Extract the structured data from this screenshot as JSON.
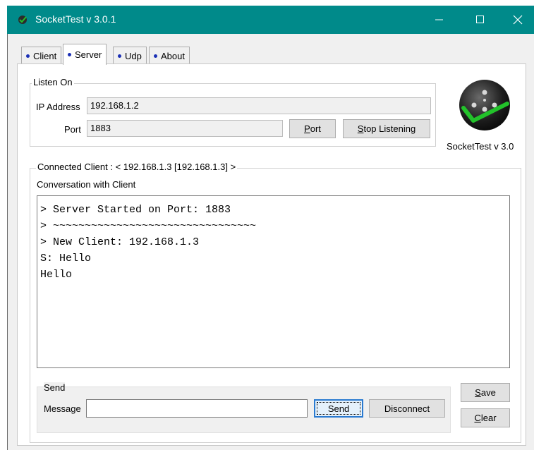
{
  "window": {
    "title": "SocketTest v 3.0.1",
    "controls": {
      "minimize": "—",
      "maximize": "☐",
      "close": "✕"
    }
  },
  "tabs": [
    {
      "label": "Client",
      "active": false
    },
    {
      "label": "Server",
      "active": true
    },
    {
      "label": "Udp",
      "active": false
    },
    {
      "label": "About",
      "active": false
    }
  ],
  "listen": {
    "legend": "Listen On",
    "ip_label": "IP Address",
    "ip_value": "192.168.1.2",
    "port_label": "Port",
    "port_value": "1883",
    "port_button_first": "P",
    "port_button_rest": "ort",
    "stop_button_first": "S",
    "stop_button_rest": "top Listening"
  },
  "logo": {
    "caption": "SocketTest v 3.0",
    "icon": "socket-logo-icon"
  },
  "connected": {
    "legend": "Connected Client : <  192.168.1.3 [192.168.1.3]  >",
    "conversation_label": "Conversation with Client",
    "lines": [
      "> Server Started on Port: 1883",
      "> ~~~~~~~~~~~~~~~~~~~~~~~~~~~~~~~~",
      "> New Client: 192.168.1.3",
      "S: Hello",
      "Hello"
    ]
  },
  "send": {
    "legend": "Send",
    "message_label": "Message",
    "message_value": "",
    "send_button": "Send",
    "disconnect_button": "Disconnect"
  },
  "side_buttons": {
    "save_first": "S",
    "save_rest": "ave",
    "clear_first": "C",
    "clear_rest": "lear"
  },
  "colors": {
    "titlebar": "#008a8a",
    "tab_dot": "#1a2fb5",
    "logo_check": "#22c22a"
  }
}
